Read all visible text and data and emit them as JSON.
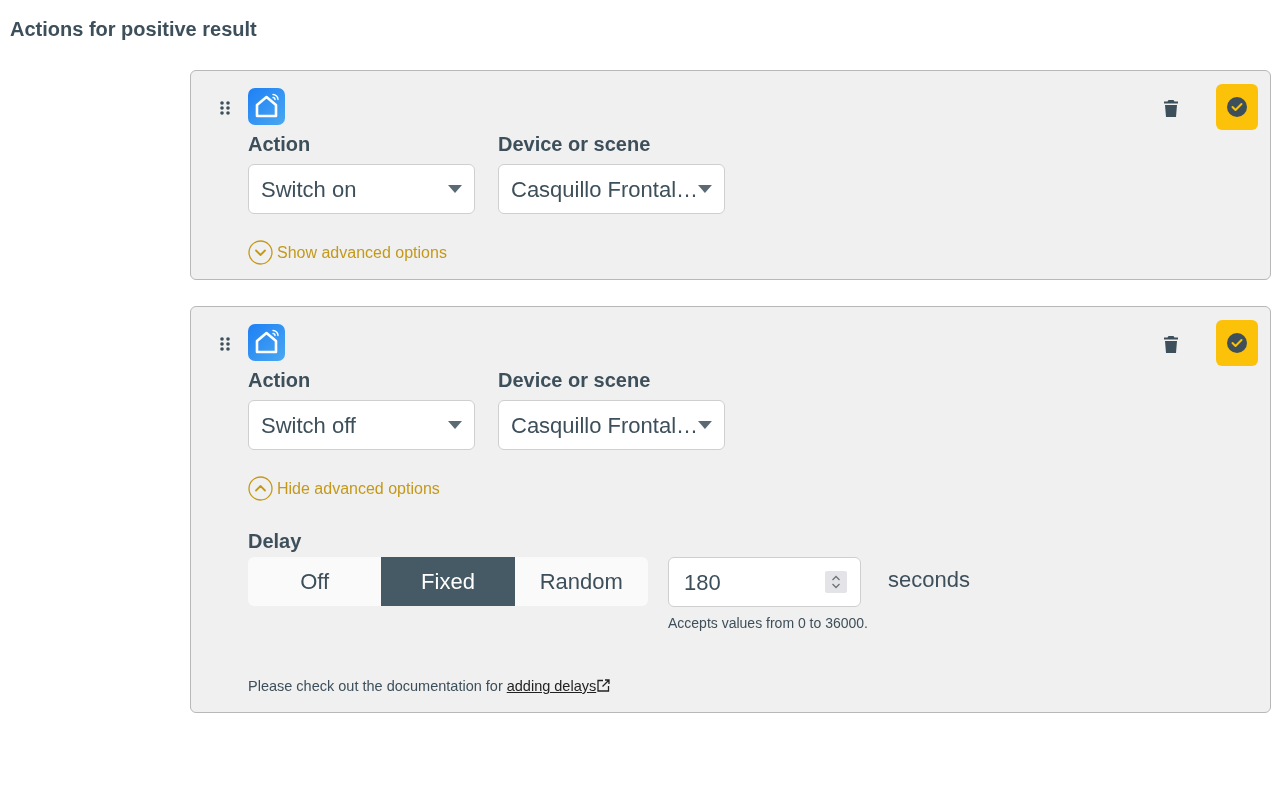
{
  "title": "Actions for positive result",
  "cards": [
    {
      "action_label": "Action",
      "action_value": "Switch on",
      "device_label": "Device or scene",
      "device_value": "Casquillo Frontal…",
      "advanced_expanded": false,
      "advanced_toggle": "Show advanced options"
    },
    {
      "action_label": "Action",
      "action_value": "Switch off",
      "device_label": "Device or scene",
      "device_value": "Casquillo Frontal…",
      "advanced_expanded": true,
      "advanced_toggle": "Hide advanced options",
      "delay": {
        "label": "Delay",
        "options": [
          {
            "label": "Off",
            "selected": false
          },
          {
            "label": "Fixed",
            "selected": true
          },
          {
            "label": "Random",
            "selected": false
          }
        ],
        "value": "180",
        "unit": "seconds",
        "hint": "Accepts values from 0 to 36000.",
        "doc_text": "Please check out the documentation for",
        "doc_link": "adding delays"
      }
    }
  ]
}
